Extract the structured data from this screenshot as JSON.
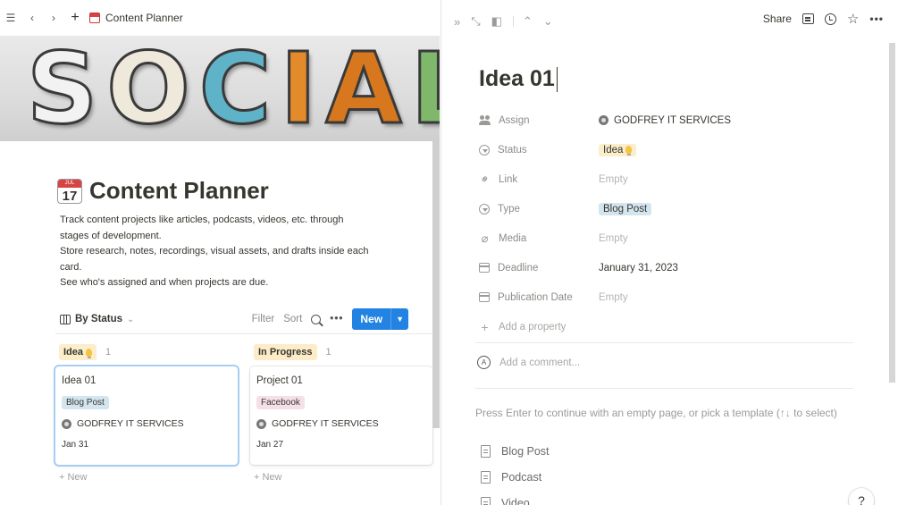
{
  "left": {
    "breadcrumb": {
      "title": "Content Planner"
    },
    "cover_letters": [
      {
        "ch": "S",
        "color": "#f2f2f2"
      },
      {
        "ch": "O",
        "color": "#efe9dc"
      },
      {
        "ch": "C",
        "color": "#5fb3c8"
      },
      {
        "ch": "I",
        "color": "#e38a2a"
      },
      {
        "ch": "A",
        "color": "#d7781f"
      },
      {
        "ch": "L",
        "color": "#7fb86a"
      }
    ],
    "page": {
      "title": "Content Planner",
      "calendar_month": "JUL",
      "calendar_day": "17",
      "description": [
        "Track content projects like articles, podcasts, videos, etc. through stages of development.",
        "Store research, notes, recordings, visual assets, and drafts inside each card.",
        "See who's assigned and when projects are due."
      ]
    },
    "view": {
      "name": "By Status",
      "filter": "Filter",
      "sort": "Sort",
      "more": "•••",
      "new": "New"
    },
    "columns": [
      {
        "status": "Idea",
        "count": "1",
        "card": {
          "title": "Idea 01",
          "type": "Blog Post",
          "owner": "GODFREY IT SERVICES",
          "date": "Jan 31"
        },
        "new_label": "+ New"
      },
      {
        "status": "In Progress",
        "count": "1",
        "card": {
          "title": "Project 01",
          "type": "Facebook",
          "owner": "GODFREY IT SERVICES",
          "date": "Jan 27"
        },
        "new_label": "+ New"
      }
    ]
  },
  "right": {
    "toolbar": {
      "share": "Share"
    },
    "title": "Idea 01",
    "properties": [
      {
        "label": "Assign",
        "value": "GODFREY IT SERVICES"
      },
      {
        "label": "Status",
        "value": "Idea"
      },
      {
        "label": "Link",
        "value": "Empty"
      },
      {
        "label": "Type",
        "value": "Blog Post"
      },
      {
        "label": "Media",
        "value": "Empty"
      },
      {
        "label": "Deadline",
        "value": "January 31, 2023"
      },
      {
        "label": "Publication Date",
        "value": "Empty"
      }
    ],
    "add_property": "Add a property",
    "comment_avatar": "A",
    "comment_placeholder": "Add a comment...",
    "hint": "Press Enter to continue with an empty page, or pick a template (↑↓ to select)",
    "templates": [
      "Blog Post",
      "Podcast",
      "Video"
    ],
    "help": "?"
  }
}
